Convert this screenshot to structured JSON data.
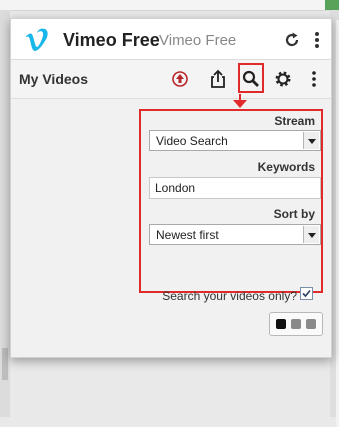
{
  "header": {
    "app_name": "Vimeo Free",
    "app_subtitle": "Vimeo Free",
    "reload_icon": "reload-icon",
    "menu_icon": "vertical-dots-icon"
  },
  "toolbar": {
    "title": "My Videos",
    "icons": [
      "upload-circle-icon",
      "share-icon",
      "search-icon",
      "gear-icon",
      "vertical-dots-icon"
    ]
  },
  "search_form": {
    "stream_label": "Stream",
    "stream_value": "Video Search",
    "keywords_label": "Keywords",
    "keywords_value": "London",
    "sort_label": "Sort by",
    "sort_value": "Newest first",
    "own_videos_label": "Search your videos only?",
    "own_videos_checked": true
  },
  "theme_switcher": {
    "swatches": [
      "#111111",
      "#8a8a8a",
      "#8a8a8a"
    ]
  },
  "colors": {
    "brand": "#1ab7ea",
    "highlight": "#e12b2b",
    "upload_icon": "#b8262a"
  }
}
